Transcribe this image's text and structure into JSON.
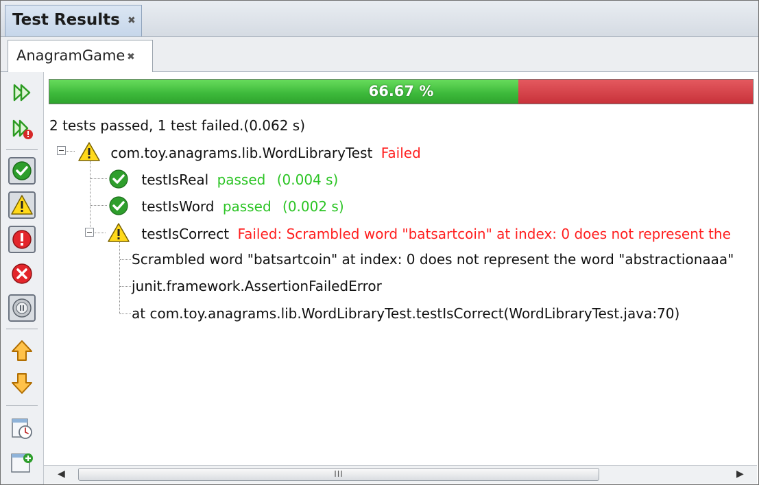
{
  "window": {
    "title": "Test Results"
  },
  "subtab": {
    "label": "AnagramGame"
  },
  "progress": {
    "percent": 66.67,
    "label": "66.67 %",
    "pass_color": "#3cb83a",
    "fail_color": "#d03a40"
  },
  "summary": "2 tests passed, 1 test failed.(0.062 s)",
  "suite": {
    "name": "com.toy.anagrams.lib.WordLibraryTest",
    "status": "Failed"
  },
  "tests": [
    {
      "name": "testIsReal",
      "status": "passed",
      "time": "(0.004 s)"
    },
    {
      "name": "testIsWord",
      "status": "passed",
      "time": "(0.002 s)"
    },
    {
      "name": "testIsCorrect",
      "status": "Failed: Scrambled word \"batsartcoin\" at index: 0 does not represent the"
    }
  ],
  "failure_details": [
    "Scrambled word \"batsartcoin\" at index: 0 does not represent the word \"abstractionaaa\"",
    "junit.framework.AssertionFailedError",
    "at com.toy.anagrams.lib.WordLibraryTest.testIsCorrect(WordLibraryTest.java:70)"
  ],
  "toolbar": {
    "icons": [
      "rerun-icon",
      "rerun-failed-icon",
      "show-passed-icon",
      "show-passed-with-errors-icon",
      "show-failures-icon",
      "show-errors-icon",
      "show-aborted-icon",
      "previous-failure-icon",
      "next-failure-icon",
      "test-history-icon",
      "new-test-icon"
    ]
  },
  "scrollbar": {
    "grip": "III"
  }
}
